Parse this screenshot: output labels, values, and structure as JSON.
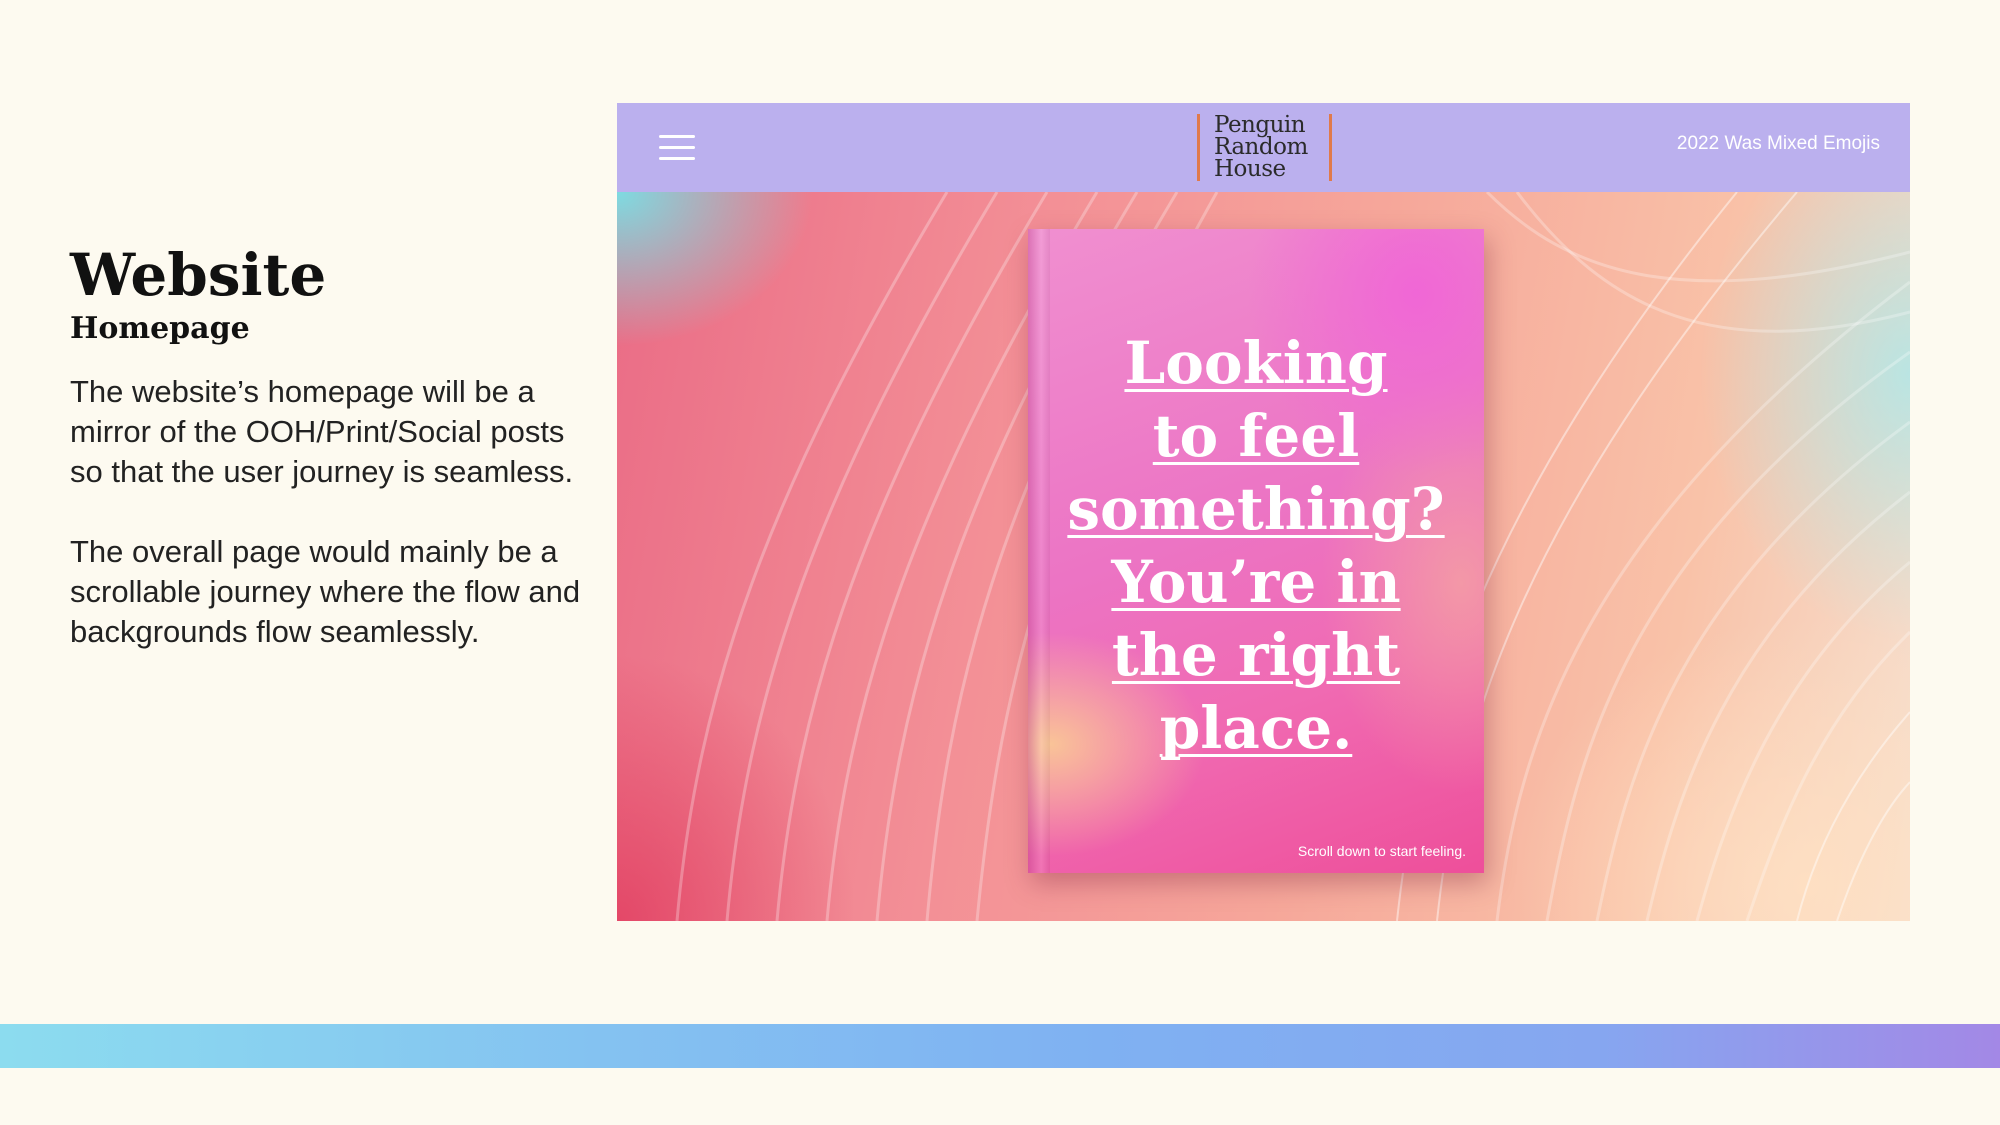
{
  "slide": {
    "title": "Website",
    "subtitle": "Homepage",
    "paragraphs": [
      "The website’s homepage will be a mirror of the OOH/Print/Social posts so that the user journey is seamless.",
      "The overall page would mainly be a scrollable journey where the flow and backgrounds flow seamlessly."
    ]
  },
  "website": {
    "header": {
      "menu_icon": "hamburger-menu-icon",
      "logo_lines": [
        "Penguin",
        "Random",
        "House"
      ],
      "nav_link": "2022 Was Mixed Emojis",
      "background": "#bbb0ee",
      "logo_rule_color": "#e07a4b"
    },
    "hero": {
      "headline_lines": [
        "Looking",
        "to feel",
        "something?",
        "You’re in",
        "the right",
        "place."
      ],
      "cta": "Scroll down to start feeling."
    }
  },
  "footer_bar": {
    "gradient_colors": [
      "#8cdcef",
      "#7fb1f2",
      "#a388e6"
    ]
  }
}
